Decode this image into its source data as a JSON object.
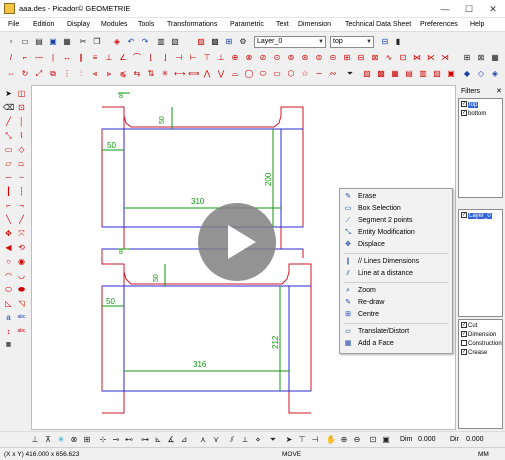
{
  "window": {
    "title": "aaa.des - Picador© GEOMETRIE",
    "minimize": "—",
    "maximize": "☐",
    "close": "✕"
  },
  "menu": [
    "File",
    "Edition",
    "Display",
    "Modules",
    "Tools",
    "Transformations",
    "Parametric",
    "Text",
    "Dimension",
    "Technical Data Sheet",
    "Preferences",
    "Help"
  ],
  "toolbar": {
    "layer_combo": "Layer_0",
    "view_combo": "top"
  },
  "drawing": {
    "dims_top": [
      "8",
      "50",
      "50",
      "310",
      "200"
    ],
    "dims_bottom": [
      "8",
      "50",
      "50",
      "316",
      "212"
    ]
  },
  "filters": {
    "header": "Filters",
    "views": [
      {
        "label": "top",
        "checked": true,
        "selected": true
      },
      {
        "label": "bottom",
        "checked": true,
        "selected": false
      }
    ],
    "layers": [
      {
        "label": "Layer_0",
        "checked": true,
        "selected": true
      }
    ],
    "types": [
      {
        "label": "Cut",
        "checked": true
      },
      {
        "label": "Dimension",
        "checked": true
      },
      {
        "label": "Construction",
        "checked": false
      },
      {
        "label": "Crease",
        "checked": true
      }
    ]
  },
  "context_menu": {
    "groups": [
      [
        {
          "label": "Erase",
          "icon": "erase-icon"
        },
        {
          "label": "Box Selection",
          "icon": "box-selection-icon"
        },
        {
          "label": "Segment 2 points",
          "icon": "segment-icon"
        },
        {
          "label": "Entity Modification",
          "icon": "entity-modification-icon"
        },
        {
          "label": "Displace",
          "icon": "displace-icon"
        }
      ],
      [
        {
          "label": "// Lines Dimensions",
          "icon": "line-dimensions-icon"
        },
        {
          "label": "Line at a distance",
          "icon": "line-distance-icon"
        }
      ],
      [
        {
          "label": "Zoom",
          "icon": "zoom-icon"
        },
        {
          "label": "Re-draw",
          "icon": "redraw-icon"
        },
        {
          "label": "Centre",
          "icon": "centre-icon"
        }
      ],
      [
        {
          "label": "Translate/Distort",
          "icon": "translate-icon"
        },
        {
          "label": "Add a Face",
          "icon": "add-face-icon"
        }
      ]
    ]
  },
  "bottom": {
    "dim_label": "Dim",
    "dim_value": "0.000",
    "dir_label": "Dir",
    "dir_value": "0.000"
  },
  "status": {
    "coords": "(X x Y) 416.000 x 656.623",
    "mode": "MOVE",
    "unit": "MM"
  },
  "colors": {
    "cut": "#d0142a",
    "crease": "#2a2ad0",
    "dimension": "#109a10",
    "play_overlay": "#808080"
  }
}
